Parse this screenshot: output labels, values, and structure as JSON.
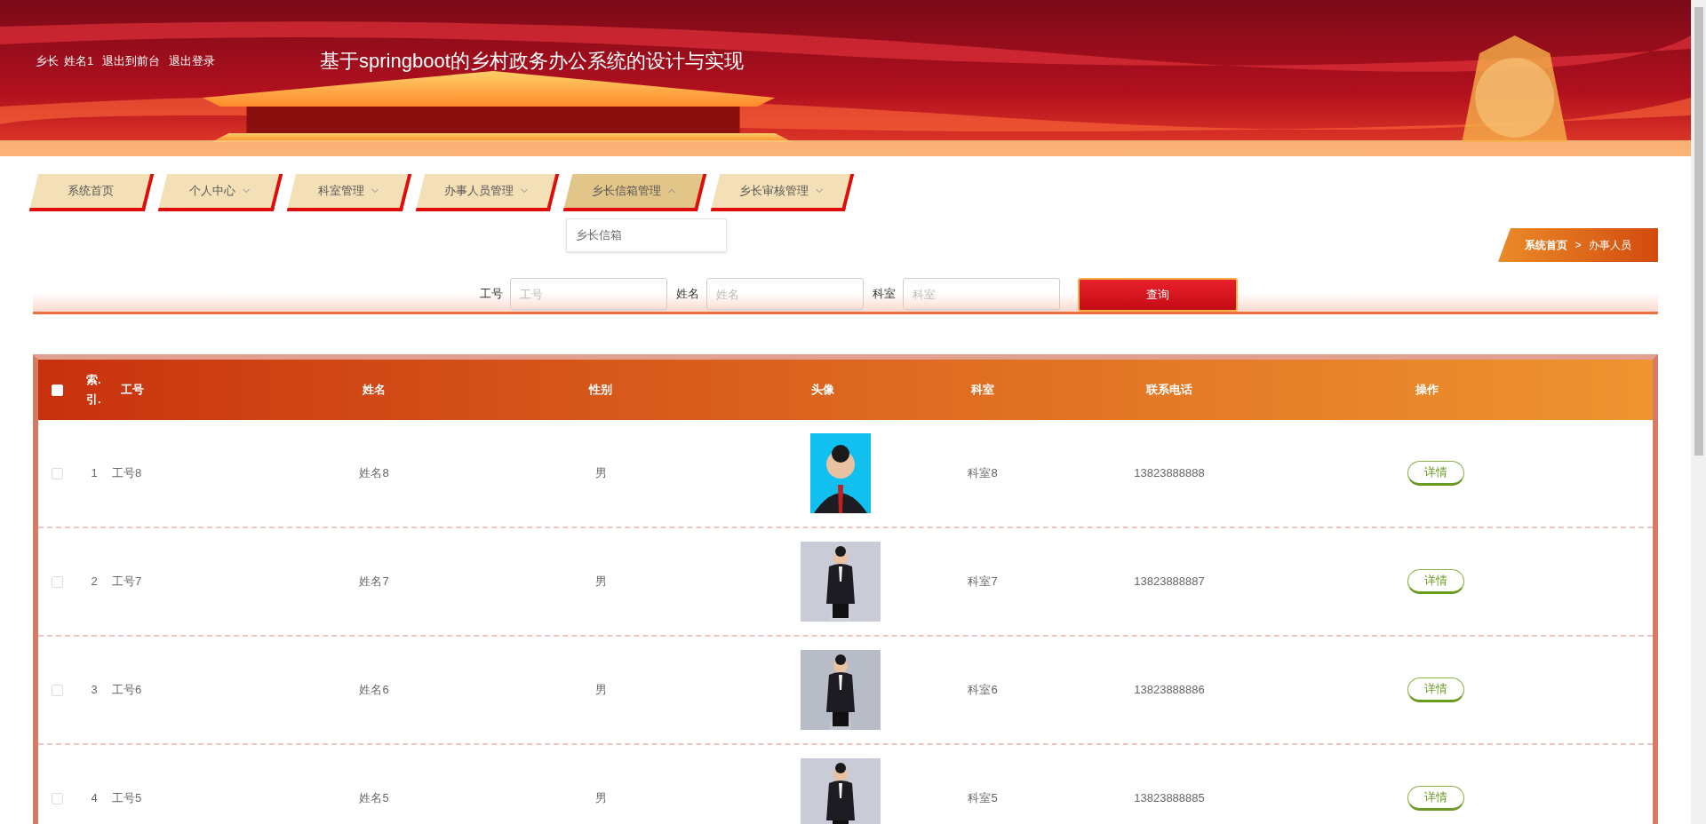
{
  "header": {
    "user_role": "乡长",
    "user_name": "姓名1",
    "links": [
      "退出到前台",
      "退出登录"
    ],
    "title": "基于springboot的乡村政务办公系统的设计与实现"
  },
  "nav": [
    {
      "label": "系统首页",
      "kind": "link",
      "expanded": false
    },
    {
      "label": "个人中心",
      "kind": "menu",
      "expanded": false
    },
    {
      "label": "科室管理",
      "kind": "menu",
      "expanded": false
    },
    {
      "label": "办事人员管理",
      "kind": "menu",
      "expanded": false
    },
    {
      "label": "乡长信箱管理",
      "kind": "menu",
      "expanded": true,
      "items": [
        "乡长信箱"
      ]
    },
    {
      "label": "乡长审核管理",
      "kind": "menu",
      "expanded": false
    }
  ],
  "breadcrumb": {
    "items": [
      "系统首页",
      "办事人员"
    ],
    "separator": ">"
  },
  "search": {
    "fields": [
      {
        "label": "工号",
        "placeholder": "工号"
      },
      {
        "label": "姓名",
        "placeholder": "姓名"
      },
      {
        "label": "科室",
        "placeholder": "科室"
      }
    ],
    "button": "查询"
  },
  "table": {
    "columns": [
      "索.引.",
      "工号",
      "姓名",
      "性别",
      "头像",
      "科室",
      "联系电话",
      "操作"
    ],
    "all_checked": false,
    "rows": [
      {
        "checked": false,
        "index": "1",
        "id": "工号8",
        "name": "姓名8",
        "gender": "男",
        "dept": "科室8",
        "phone": "13823888888",
        "action": "详情"
      },
      {
        "checked": false,
        "index": "2",
        "id": "工号7",
        "name": "姓名7",
        "gender": "男",
        "dept": "科室7",
        "phone": "13823888887",
        "action": "详情"
      },
      {
        "checked": false,
        "index": "3",
        "id": "工号6",
        "name": "姓名6",
        "gender": "男",
        "dept": "科室6",
        "phone": "13823888886",
        "action": "详情"
      },
      {
        "checked": false,
        "index": "4",
        "id": "工号5",
        "name": "姓名5",
        "gender": "男",
        "dept": "科室5",
        "phone": "13823888885",
        "action": "详情"
      }
    ]
  }
}
